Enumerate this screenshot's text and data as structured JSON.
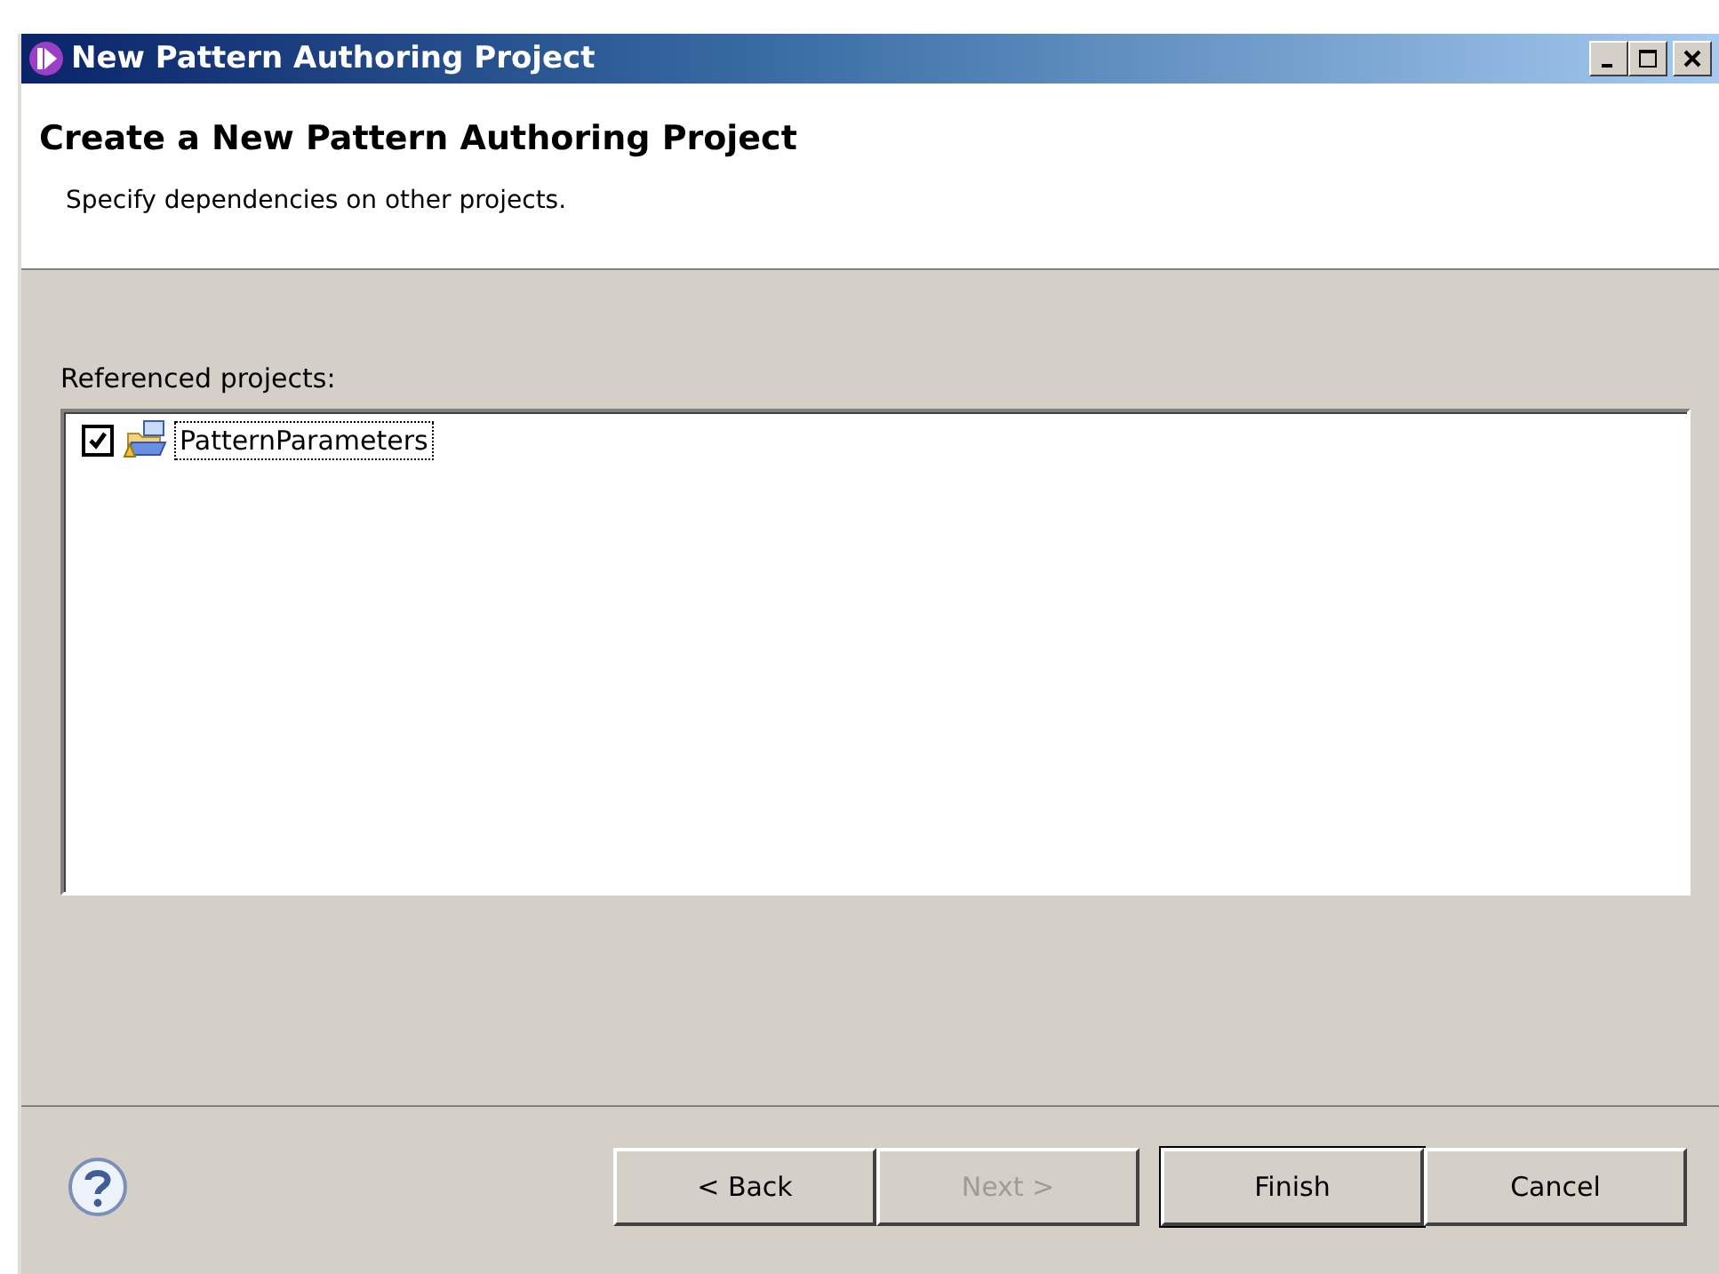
{
  "window": {
    "title": "New Pattern Authoring Project"
  },
  "header": {
    "title": "Create a New Pattern Authoring Project",
    "description": "Specify dependencies on other projects."
  },
  "referenced_projects": {
    "label": "Referenced projects:",
    "items": [
      {
        "name": "PatternParameters",
        "checked": true,
        "selected": true
      }
    ]
  },
  "buttons": [
    {
      "label": "< Back",
      "disabled": false,
      "default": false
    },
    {
      "label": "Next >",
      "disabled": true,
      "default": false
    },
    {
      "label": "Finish",
      "disabled": false,
      "default": true
    },
    {
      "label": "Cancel",
      "disabled": false,
      "default": false
    }
  ]
}
